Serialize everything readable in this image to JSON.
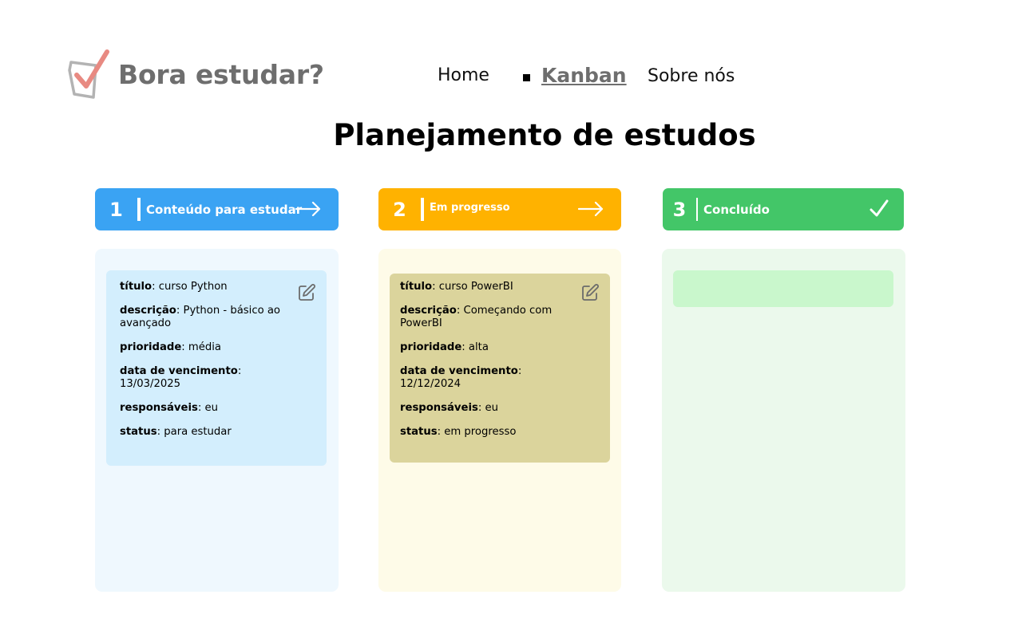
{
  "brand": {
    "name": "Bora estudar?",
    "logo_icon": "checkbox-check-icon",
    "logo_colors": {
      "box": "#b3b3b3",
      "check": "#e88a82"
    }
  },
  "nav": {
    "items": [
      "Home",
      "Kanban",
      "Sobre nós"
    ],
    "active": "Kanban"
  },
  "page_title": "Planejamento de estudos",
  "columns": [
    {
      "number": "1",
      "title": "Conteúdo para estudar",
      "icon": "arrow-right-icon",
      "header_color": "#3aa3f3",
      "body_color": "#eff8fe",
      "cards": [
        {
          "titulo_label": "título",
          "titulo": "curso Python",
          "descricao_label": "descrição",
          "descricao": "Python - básico ao avançado",
          "prioridade_label": "prioridade",
          "prioridade": "média",
          "vencimento_label": "data de vencimento",
          "vencimento": "13/03/2025",
          "responsaveis_label": "responsáveis",
          "responsaveis": "eu",
          "status_label": "status",
          "status": "para estudar",
          "color": "#d3eefd"
        }
      ]
    },
    {
      "number": "2",
      "title": "Em progresso",
      "icon": "arrow-right-icon",
      "header_color": "#ffb200",
      "body_color": "#fefbe8",
      "cards": [
        {
          "titulo_label": "título",
          "titulo": "curso PowerBI",
          "descricao_label": "descrição",
          "descricao": "Começando com PowerBI",
          "prioridade_label": "prioridade",
          "prioridade": "alta",
          "vencimento_label": "data de vencimento",
          "vencimento": "12/12/2024",
          "responsaveis_label": "responsáveis",
          "responsaveis": "eu",
          "status_label": "status",
          "status": "em progresso",
          "color": "#dbd49c"
        }
      ]
    },
    {
      "number": "3",
      "title": "Concluído",
      "icon": "checkmark-icon",
      "header_color": "#43c668",
      "body_color": "#ebf9ec",
      "cards": [
        {
          "color": "#c9f7cc"
        }
      ]
    }
  ],
  "card_action_icon": "edit-icon"
}
